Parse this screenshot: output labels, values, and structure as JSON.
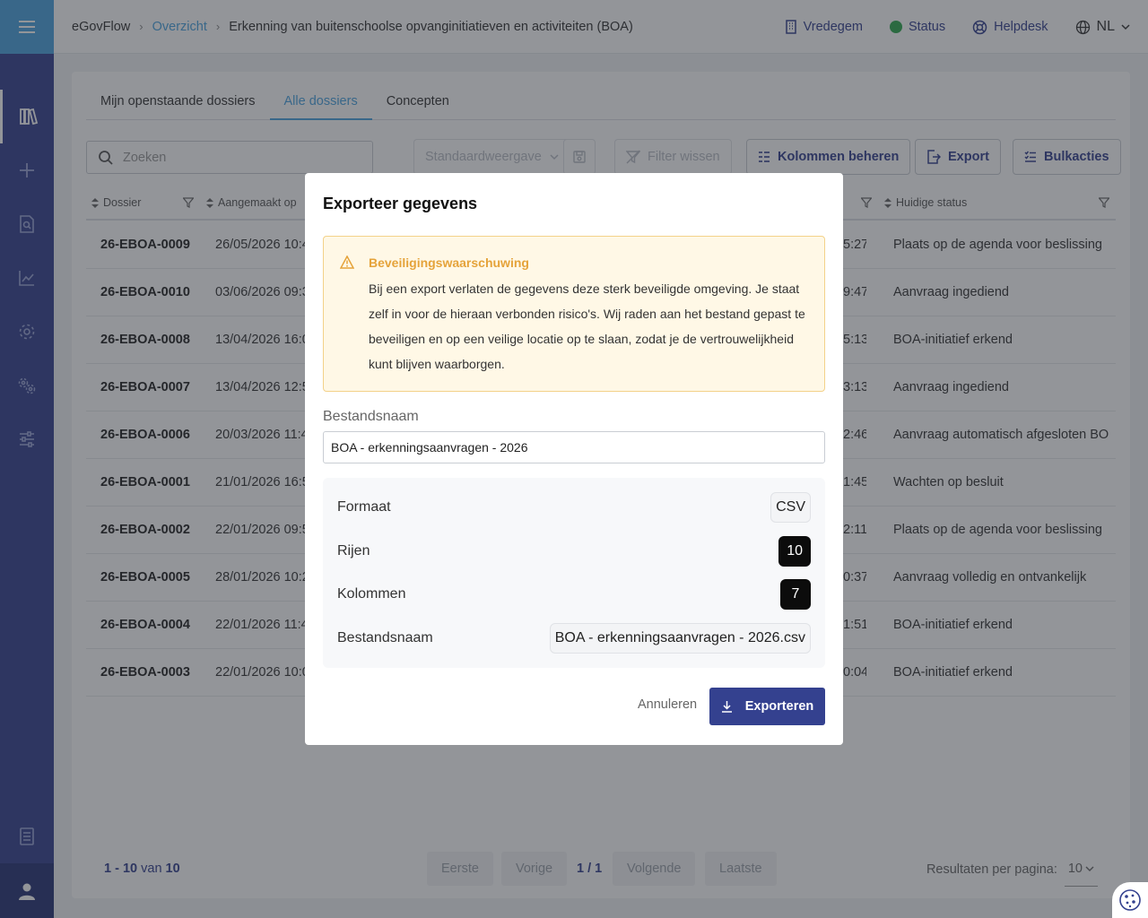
{
  "topbar": {
    "app_name": "eGovFlow",
    "breadcrumb_overview": "Overzicht",
    "breadcrumb_current": "Erkenning van buitenschoolse opvanginitiatieven en activiteiten (BOA)",
    "municipality": "Vredegem",
    "status_label": "Status",
    "helpdesk_label": "Helpdesk",
    "language": "NL",
    "status_color": "#2fa84f"
  },
  "sidebar": {
    "items": [
      "library-icon",
      "plus-icon",
      "search-document-icon",
      "chart-icon",
      "gear-icon",
      "gears-icon",
      "sliders-icon",
      "book-icon",
      "user-icon"
    ],
    "accent_color": "#34418f"
  },
  "tabs": [
    {
      "label": "Mijn openstaande dossiers",
      "active": false
    },
    {
      "label": "Alle dossiers",
      "active": true
    },
    {
      "label": "Concepten",
      "active": false
    }
  ],
  "toolbar": {
    "search_placeholder": "Zoeken",
    "view_label": "Standaardweergave",
    "clear_filter_label": "Filter wissen",
    "manage_columns_label": "Kolommen beheren",
    "export_label": "Export",
    "bulk_label": "Bulkacties"
  },
  "table": {
    "headers": {
      "dossier": "Dossier",
      "created": "Aangemaakt op",
      "status": "Huidige status"
    },
    "rows": [
      {
        "dossier": "26-EBOA-0009",
        "created": "26/05/2026 10:4",
        "time": "5:27",
        "status": "Plaats op de agenda voor beslissing"
      },
      {
        "dossier": "26-EBOA-0010",
        "created": "03/06/2026 09:3",
        "time": "9:47",
        "status": "Aanvraag ingediend"
      },
      {
        "dossier": "26-EBOA-0008",
        "created": "13/04/2026 16:0",
        "time": "5:13",
        "status": "BOA-initiatief erkend"
      },
      {
        "dossier": "26-EBOA-0007",
        "created": "13/04/2026 12:5",
        "time": "3:13",
        "status": "Aanvraag ingediend"
      },
      {
        "dossier": "26-EBOA-0006",
        "created": "20/03/2026 11:4",
        "time": "2:46",
        "status": "Aanvraag automatisch afgesloten BO"
      },
      {
        "dossier": "26-EBOA-0001",
        "created": "21/01/2026 16:5",
        "time": "1:45",
        "status": "Wachten op besluit"
      },
      {
        "dossier": "26-EBOA-0002",
        "created": "22/01/2026 09:5",
        "time": "2:11",
        "status": "Plaats op de agenda voor beslissing"
      },
      {
        "dossier": "26-EBOA-0005",
        "created": "28/01/2026 10:2",
        "time": "0:37",
        "status": "Aanvraag volledig en ontvankelijk"
      },
      {
        "dossier": "26-EBOA-0004",
        "created": "22/01/2026 11:4",
        "time": "1:51",
        "status": "BOA-initiatief erkend"
      },
      {
        "dossier": "26-EBOA-0003",
        "created": "22/01/2026 10:0",
        "time": "0:04",
        "status": "BOA-initiatief erkend"
      }
    ]
  },
  "pagination": {
    "range": "1 - 10",
    "of_label": "van",
    "total": "10",
    "first": "Eerste",
    "previous": "Vorige",
    "current": "1 / 1",
    "next": "Volgende",
    "last": "Laatste",
    "per_page_label": "Resultaten per pagina:",
    "per_page_value": "10"
  },
  "modal": {
    "title": "Exporteer gegevens",
    "warning_title": "Beveiligingswaarschuwing",
    "warning_text": "Bij een export verlaten de gegevens deze sterk beveiligde omgeving. Je staat zelf in voor de hieraan verbonden risico's. Wij raden aan het bestand gepast te beveiligen en op een veilige locatie op te slaan, zodat je de vertrouwelijkheid kunt blijven waarborgen.",
    "filename_label": "Bestandsnaam",
    "filename_value": "BOA - erkenningsaanvragen - 2026",
    "summary": {
      "format_label": "Formaat",
      "format_value": "CSV",
      "rows_label": "Rijen",
      "rows_value": "10",
      "columns_label": "Kolommen",
      "columns_value": "7",
      "filename_label": "Bestandsnaam",
      "filename_value": "BOA - erkenningsaanvragen - 2026.csv"
    },
    "cancel_label": "Annuleren",
    "export_label": "Exporteren",
    "warning_color": "#e5a33a",
    "primary_color": "#34418f"
  }
}
